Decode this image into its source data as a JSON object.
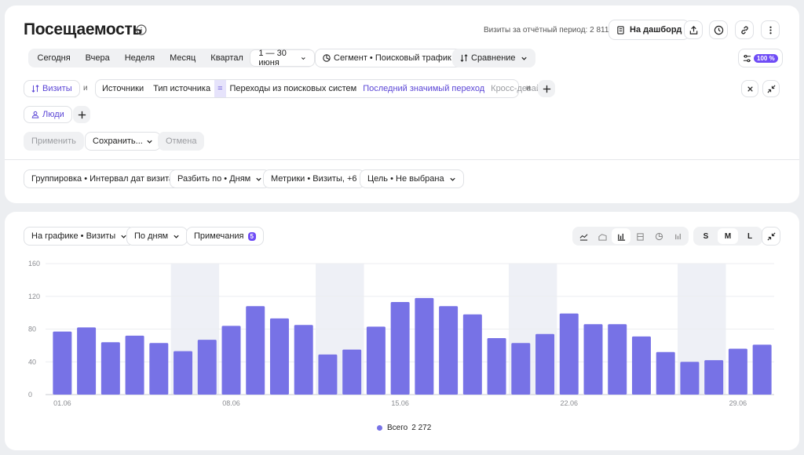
{
  "header": {
    "title": "Посещаемость",
    "visits_label": "Визиты за отчётный период: 2 811",
    "dashboard_button": "На дашборд"
  },
  "periods": {
    "items": [
      "Сегодня",
      "Вчера",
      "Неделя",
      "Месяц",
      "Квартал"
    ],
    "date_range": "1 — 30 июня"
  },
  "segment_label": "Сегмент • Поисковый трафик",
  "comparison_label": "Сравнение",
  "sampling_badge": "100 %",
  "filters": {
    "visits_chip": "Визиты",
    "and_1": "и",
    "and_2": "и",
    "sources": "Источники",
    "source_type": "Тип источника",
    "equals": "=",
    "value": "Переходы из поисковых систем",
    "attribution": "Последний значимый переход",
    "cross_device": "Кросс-девайс",
    "people_chip": "Люди"
  },
  "actions": {
    "apply": "Применить",
    "save": "Сохранить...",
    "cancel": "Отмена"
  },
  "settings": {
    "grouping": "Группировка • Интервал дат визита",
    "split": "Разбить по • Дням",
    "metrics": "Метрики • Визиты, +6",
    "goal": "Цель • Не выбрана"
  },
  "chart_controls": {
    "on_chart": "На графике • Визиты",
    "by_days": "По дням",
    "notes": "Примечания",
    "notes_count": "5",
    "sizes": [
      "S",
      "M",
      "L"
    ],
    "active_size": "M"
  },
  "colors": {
    "bar": "#7772e6",
    "weekend_band": "#eef0f6",
    "accent": "#5b46d6"
  },
  "chart_data": {
    "type": "bar",
    "x": [
      "01.06",
      "02.06",
      "03.06",
      "04.06",
      "05.06",
      "06.06",
      "07.06",
      "08.06",
      "09.06",
      "10.06",
      "11.06",
      "12.06",
      "13.06",
      "14.06",
      "15.06",
      "16.06",
      "17.06",
      "18.06",
      "19.06",
      "20.06",
      "21.06",
      "22.06",
      "23.06",
      "24.06",
      "25.06",
      "26.06",
      "27.06",
      "28.06",
      "29.06",
      "30.06"
    ],
    "x_tick_labels": [
      "01.06",
      "08.06",
      "15.06",
      "22.06",
      "29.06"
    ],
    "values": [
      77,
      82,
      64,
      72,
      63,
      53,
      67,
      84,
      108,
      93,
      85,
      49,
      55,
      83,
      113,
      118,
      108,
      98,
      69,
      63,
      74,
      99,
      86,
      86,
      71,
      52,
      40,
      42,
      56,
      61
    ],
    "weekend_bands": [
      [
        "06.06",
        "07.06"
      ],
      [
        "12.06",
        "13.06"
      ],
      [
        "20.06",
        "21.06"
      ],
      [
        "27.06",
        "28.06"
      ]
    ],
    "y_ticks": [
      0,
      40,
      80,
      120,
      160
    ],
    "ylim": [
      0,
      160
    ],
    "legend": {
      "name": "Всего",
      "total": "2 272"
    }
  }
}
